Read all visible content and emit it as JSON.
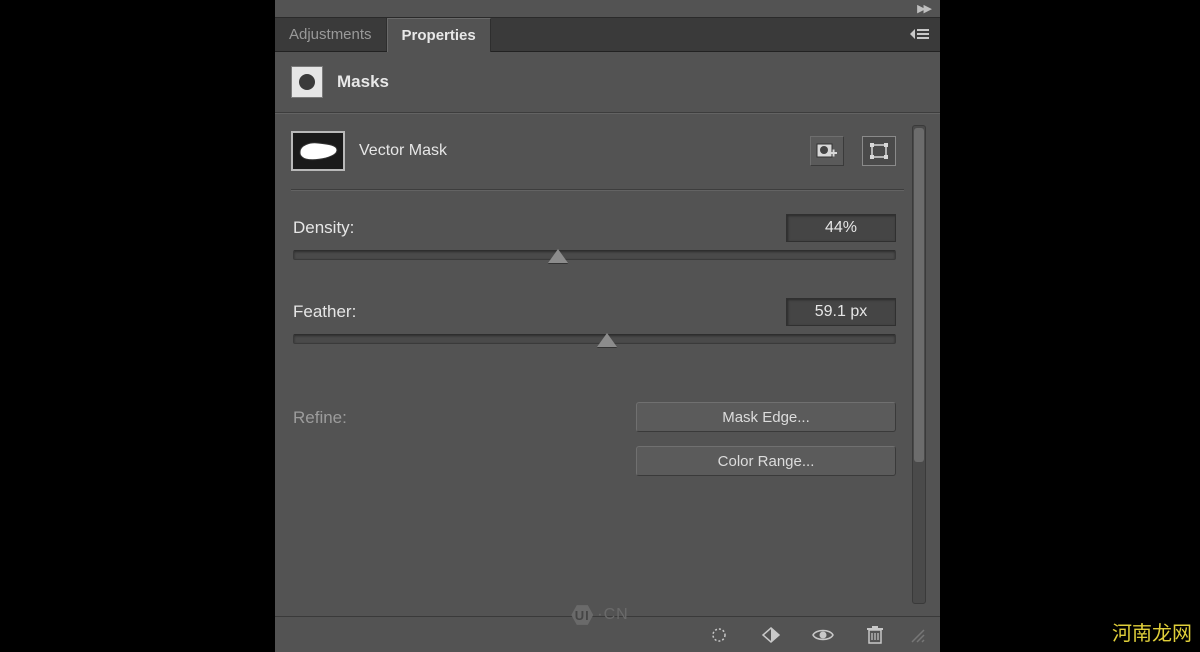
{
  "tabs": {
    "adjustments": "Adjustments",
    "properties": "Properties"
  },
  "section": {
    "title": "Masks"
  },
  "mask": {
    "label": "Vector Mask"
  },
  "density": {
    "label": "Density:",
    "value": "44%",
    "percent": 44
  },
  "feather": {
    "label": "Feather:",
    "value": "59.1 px",
    "percent": 52
  },
  "refine": {
    "label": "Refine:",
    "mask_edge": "Mask Edge...",
    "color_range": "Color Range..."
  },
  "watermarks": {
    "left_badge": "UI",
    "left_suffix": "·CN",
    "right": "河南龙网"
  }
}
